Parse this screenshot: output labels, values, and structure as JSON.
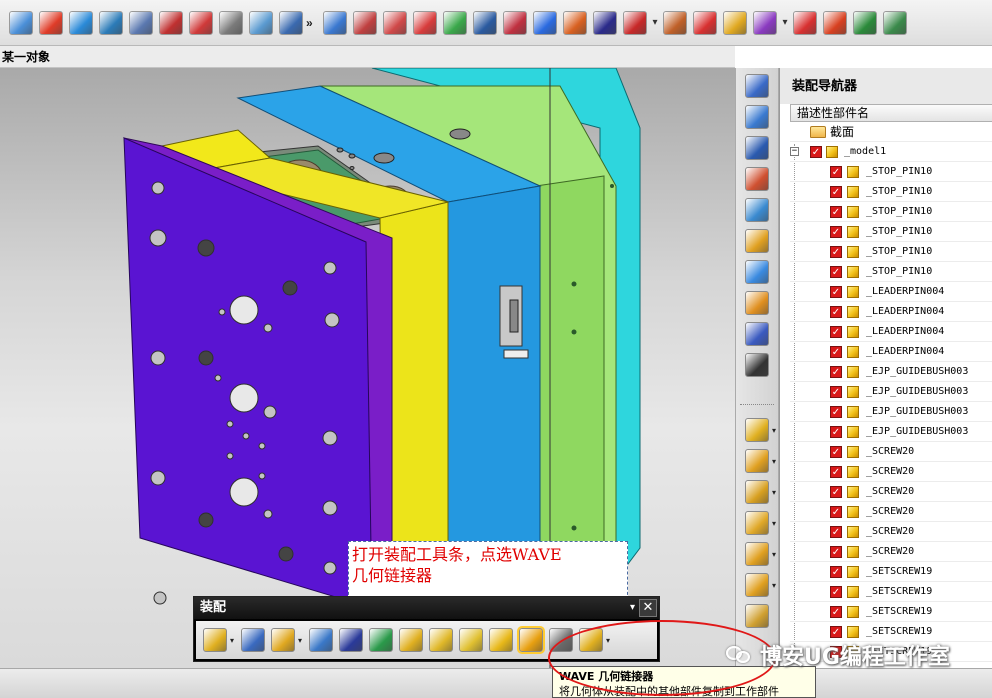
{
  "selection_bar": {
    "label": "某一对象"
  },
  "top_toolbar": {
    "overflow_glyph": "»",
    "dropdown_glyph": "▾",
    "icons": [
      {
        "name": "dropdown-arrow-icon",
        "color": "#4a8fd8"
      },
      {
        "name": "color-palette-icon",
        "color": "#e03c28"
      },
      {
        "name": "mold-wizard-icon",
        "color": "#2a8ad8"
      },
      {
        "name": "part-view-icon",
        "color": "#2b7bb8"
      },
      {
        "name": "edit-sheet-icon",
        "color": "#5a78b0"
      },
      {
        "name": "link-chain-icon",
        "color": "#c03030"
      },
      {
        "name": "rotate-icon",
        "color": "#d03a3a"
      },
      {
        "name": "draft-angle-icon",
        "color": "#7a7a7a"
      },
      {
        "name": "box-view-icon",
        "color": "#5a9ad0"
      },
      {
        "name": "grid-view-icon",
        "color": "#3a6ab0"
      },
      {
        "name": "color-fill-icon",
        "color": "#3a78d0"
      },
      {
        "name": "block-icon",
        "color": "#c04040"
      },
      {
        "name": "split-block-icon",
        "color": "#d04848"
      },
      {
        "name": "move-block-icon",
        "color": "#d83c3c"
      },
      {
        "name": "bounding-box-icon",
        "color": "#3aa84a"
      },
      {
        "name": "xyz-coords-icon",
        "color": "#2a5aa0"
      },
      {
        "name": "report-icon",
        "color": "#c03040"
      },
      {
        "name": "shading-icon",
        "color": "#2a6ae0"
      },
      {
        "name": "electrode-icon",
        "color": "#d86020"
      },
      {
        "name": "extract-icon",
        "color": "#2a2a8a"
      },
      {
        "name": "text-ab-icon",
        "color": "#c82828"
      },
      {
        "name": "material-icon",
        "color": "#c06028"
      },
      {
        "name": "mirror-icon",
        "color": "#d83030"
      },
      {
        "name": "measure-icon",
        "color": "#e0a820"
      },
      {
        "name": "assembly-icon",
        "color": "#8a3ac0"
      },
      {
        "name": "bar-chart-icon",
        "color": "#d83030"
      },
      {
        "name": "bar-chart-alt-icon",
        "color": "#d84020"
      },
      {
        "name": "table-grid-icon",
        "color": "#2a8a3a"
      },
      {
        "name": "spreadsheet-icon",
        "color": "#3a8a4a"
      }
    ]
  },
  "callout": {
    "line1": "打开装配工具条，点选WAVE",
    "line2": "几何链接器"
  },
  "assembly_toolbar": {
    "title": "装配",
    "menu_glyph": "▾",
    "close_glyph": "✕",
    "icons": [
      {
        "name": "add-component-icon",
        "color": "#e0b020",
        "dropdown": true
      },
      {
        "name": "assembly-view-icon",
        "color": "#3a6ac0",
        "dropdown": false
      },
      {
        "name": "new-component-icon",
        "color": "#e0a820",
        "dropdown": true
      },
      {
        "name": "reposition-icon",
        "color": "#3a78c8",
        "dropdown": false
      },
      {
        "name": "mirror-assembly-icon",
        "color": "#2a3a9a",
        "dropdown": false
      },
      {
        "name": "constraint-icon",
        "color": "#2a9a4a",
        "dropdown": false
      },
      {
        "name": "explode-icon",
        "color": "#e0b020",
        "dropdown": false
      },
      {
        "name": "sequence-icon",
        "color": "#e0b828",
        "dropdown": false
      },
      {
        "name": "route-icon",
        "color": "#e0c030",
        "dropdown": false
      },
      {
        "name": "product-interface-icon",
        "color": "#e8b818",
        "dropdown": false
      },
      {
        "name": "wave-linker-icon",
        "color": "#e8a010",
        "dropdown": false,
        "active": true
      },
      {
        "name": "lock-component-icon",
        "color": "#6a6a6a",
        "dropdown": false
      },
      {
        "name": "replace-component-icon",
        "color": "#e0b020",
        "dropdown": true
      }
    ]
  },
  "side_toolbar": {
    "dropdown_glyph": "▾",
    "icons": [
      {
        "name": "surface-mesh-icon",
        "color": "#3a6ac8"
      },
      {
        "name": "surface-grid-icon",
        "color": "#3a7ad0"
      },
      {
        "name": "zoom-surface-icon",
        "color": "#2a5ab0"
      },
      {
        "name": "trim-icon",
        "color": "#d05030"
      },
      {
        "name": "curve-icon",
        "color": "#3a8ad0"
      },
      {
        "name": "solid-block-icon",
        "color": "#e0a020"
      },
      {
        "name": "extrude-icon",
        "color": "#3a8ae0"
      },
      {
        "name": "fold-icon",
        "color": "#e09020"
      },
      {
        "name": "surface-patch-icon",
        "color": "#3a5ac0"
      },
      {
        "name": "axis-icon",
        "color": "#333333"
      },
      {
        "name": "add-assembly-icon",
        "color": "#e0b020"
      },
      {
        "name": "component-pattern-icon",
        "color": "#e0a020"
      },
      {
        "name": "delete-component-icon",
        "color": "#d8a020"
      },
      {
        "name": "copy-component-icon",
        "color": "#e0a828"
      },
      {
        "name": "array-component-icon",
        "color": "#e0a020"
      },
      {
        "name": "mirror-component-icon",
        "color": "#e0a020"
      },
      {
        "name": "component-table-icon",
        "color": "#d0a030"
      }
    ]
  },
  "navigator": {
    "title": "装配导航器",
    "column_header": "描述性部件名",
    "root_items": [
      {
        "label": "截面",
        "type": "folder"
      },
      {
        "label": "_model1",
        "type": "assembly",
        "expander": "⊟"
      }
    ],
    "children": [
      "_STOP_PIN10",
      "_STOP_PIN10",
      "_STOP_PIN10",
      "_STOP_PIN10",
      "_STOP_PIN10",
      "_STOP_PIN10",
      "_LEADERPIN004",
      "_LEADERPIN004",
      "_LEADERPIN004",
      "_LEADERPIN004",
      "_EJP_GUIDEBUSH003",
      "_EJP_GUIDEBUSH003",
      "_EJP_GUIDEBUSH003",
      "_EJP_GUIDEBUSH003",
      "_SCREW20",
      "_SCREW20",
      "_SCREW20",
      "_SCREW20",
      "_SCREW20",
      "_SCREW20",
      "_SETSCREW19",
      "_SETSCREW19",
      "_SETSCREW19",
      "_SETSCREW19",
      "_SETSCREW19"
    ],
    "check_glyph": "✓"
  },
  "tooltip": {
    "title": "WAVE 几何链接器",
    "description": "将几何体从装配中的其他部件复制到工作部件"
  },
  "watermark": {
    "text": "博安UG编程工作室"
  },
  "colors": {
    "viewport_bg": "#d5d5d5",
    "check_red": "#d81818",
    "callout_text": "#e00000",
    "highlight_ring": "#e01818"
  }
}
